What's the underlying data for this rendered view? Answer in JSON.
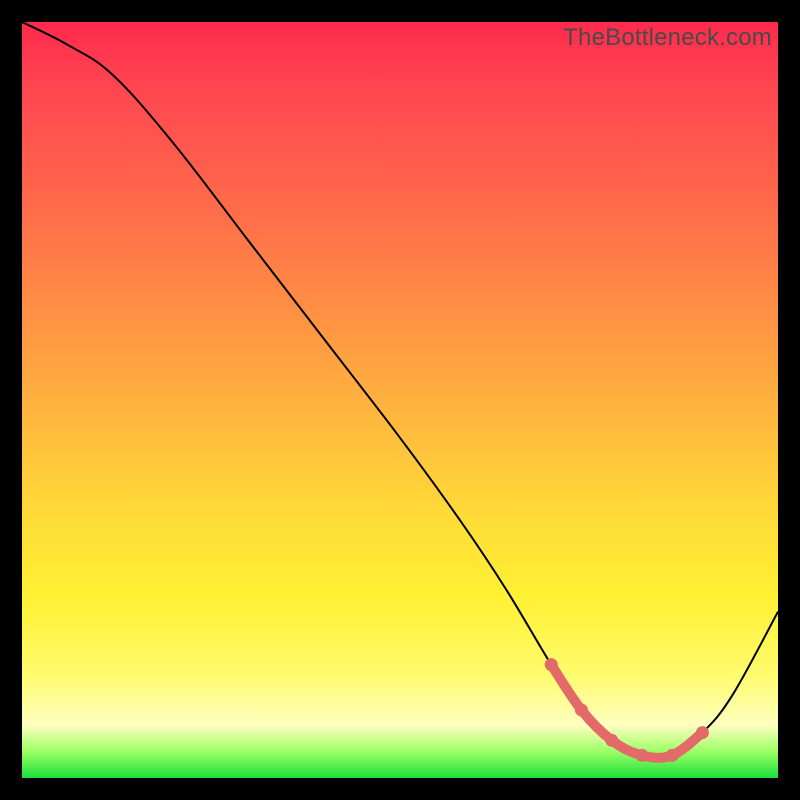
{
  "watermark": "TheBottleneck.com",
  "colors": {
    "frame": "#000000",
    "line": "#000000",
    "valley_stroke": "#e46a6a",
    "gradient_top": "#ff2a4d",
    "gradient_bottom": "#1cdf3a"
  },
  "chart_data": {
    "type": "line",
    "title": "",
    "xlabel": "",
    "ylabel": "",
    "xlim": [
      0,
      100
    ],
    "ylim": [
      0,
      100
    ],
    "grid": false,
    "legend": false,
    "series": [
      {
        "name": "bottleneck-curve",
        "x": [
          0,
          6,
          12,
          20,
          30,
          40,
          50,
          58,
          64,
          70,
          74,
          78,
          82,
          86,
          90,
          94,
          100
        ],
        "values": [
          100,
          97,
          93,
          84,
          71,
          58,
          45,
          34,
          25,
          15,
          9,
          5,
          3,
          3,
          6,
          11,
          22
        ]
      }
    ],
    "highlight_segment": {
      "name": "optimal-range",
      "color": "#e46a6a",
      "x": [
        70,
        74,
        78,
        82,
        86,
        90
      ],
      "values": [
        15,
        9,
        5,
        3,
        3,
        6
      ]
    }
  }
}
